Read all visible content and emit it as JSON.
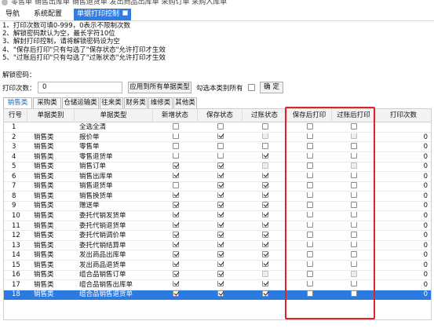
{
  "topbar": {
    "ghost_text": "零售单  销售出库单  销售退货单  发出商品出库单  采购订单  采购入库单"
  },
  "nav": {
    "items": [
      {
        "label": "导航"
      },
      {
        "label": "系统配置"
      },
      {
        "label": "单据打印控制"
      }
    ]
  },
  "notes": [
    "1、打印次数可填0-999，0表示不限制次数",
    "2、解锁密码默认为空，最长字符10位",
    "3、解封打印控制，请将解锁密码设为空",
    "4、\"保存后打印\"只有勾选了\"保存状态\"允许打印才生效",
    "5、\"过账后打印\"只有勾选了\"过账状态\"允许打印才生效"
  ],
  "password_label": "解锁密码：",
  "controls": {
    "print_count_label": "打印次数：",
    "print_count_value": "0",
    "apply_all_label": "应用到所有单据类型",
    "check_all_label": "勾选本类别所有",
    "confirm_label": "确 定"
  },
  "tabs": [
    {
      "label": "销售类",
      "active": true
    },
    {
      "label": "采购类",
      "active": false
    },
    {
      "label": "仓储运输类",
      "active": false
    },
    {
      "label": "往来类",
      "active": false
    },
    {
      "label": "财务类",
      "active": false
    },
    {
      "label": "维修类",
      "active": false
    },
    {
      "label": "其他类",
      "active": false
    }
  ],
  "table": {
    "columns": [
      "行号",
      "单据类别",
      "单据类型",
      "新增状态",
      "保存状态",
      "过账状态",
      "保存后打印",
      "过账后打印",
      "打印次数"
    ],
    "rows": [
      {
        "no": "1",
        "category": "",
        "type": "全选全清",
        "add": false,
        "save": false,
        "post": false,
        "save_print": false,
        "post_print": false,
        "count": "",
        "post_disabled": false
      },
      {
        "no": "2",
        "category": "销售类",
        "type": "报价单",
        "add": false,
        "save": true,
        "post": false,
        "save_print": false,
        "post_print": false,
        "count": "0",
        "post_disabled": true
      },
      {
        "no": "3",
        "category": "销售类",
        "type": "零售单",
        "add": false,
        "save": false,
        "post": false,
        "save_print": false,
        "post_print": false,
        "count": "0",
        "post_disabled": false
      },
      {
        "no": "4",
        "category": "销售类",
        "type": "零售退货单",
        "add": false,
        "save": false,
        "post": true,
        "save_print": false,
        "post_print": false,
        "count": "0",
        "post_disabled": false
      },
      {
        "no": "5",
        "category": "销售类",
        "type": "销售订单",
        "add": true,
        "save": true,
        "post": false,
        "save_print": false,
        "post_print": false,
        "count": "0",
        "post_disabled": true
      },
      {
        "no": "6",
        "category": "销售类",
        "type": "销售出库单",
        "add": true,
        "save": true,
        "post": true,
        "save_print": false,
        "post_print": false,
        "count": "0",
        "post_disabled": false
      },
      {
        "no": "7",
        "category": "销售类",
        "type": "销售退货单",
        "add": false,
        "save": true,
        "post": true,
        "save_print": false,
        "post_print": false,
        "count": "0",
        "post_disabled": false
      },
      {
        "no": "8",
        "category": "销售类",
        "type": "销售换货单",
        "add": true,
        "save": true,
        "post": true,
        "save_print": false,
        "post_print": false,
        "count": "0",
        "post_disabled": false
      },
      {
        "no": "9",
        "category": "销售类",
        "type": "赠送单",
        "add": true,
        "save": true,
        "post": true,
        "save_print": false,
        "post_print": false,
        "count": "0",
        "post_disabled": false
      },
      {
        "no": "10",
        "category": "销售类",
        "type": "委托代销发货单",
        "add": true,
        "save": true,
        "post": true,
        "save_print": false,
        "post_print": false,
        "count": "0",
        "post_disabled": false
      },
      {
        "no": "11",
        "category": "销售类",
        "type": "委托代销退货单",
        "add": true,
        "save": true,
        "post": true,
        "save_print": false,
        "post_print": false,
        "count": "0",
        "post_disabled": false
      },
      {
        "no": "12",
        "category": "销售类",
        "type": "委托代销调价单",
        "add": true,
        "save": true,
        "post": true,
        "save_print": false,
        "post_print": false,
        "count": "0",
        "post_disabled": false
      },
      {
        "no": "13",
        "category": "销售类",
        "type": "委托代销结算单",
        "add": true,
        "save": true,
        "post": true,
        "save_print": false,
        "post_print": false,
        "count": "0",
        "post_disabled": false
      },
      {
        "no": "14",
        "category": "销售类",
        "type": "发出商品出库单",
        "add": true,
        "save": true,
        "post": true,
        "save_print": false,
        "post_print": false,
        "count": "0",
        "post_disabled": false
      },
      {
        "no": "15",
        "category": "销售类",
        "type": "发出商品退货单",
        "add": true,
        "save": true,
        "post": true,
        "save_print": false,
        "post_print": false,
        "count": "0",
        "post_disabled": false
      },
      {
        "no": "16",
        "category": "销售类",
        "type": "组合品销售订单",
        "add": true,
        "save": true,
        "post": false,
        "save_print": false,
        "post_print": false,
        "count": "0",
        "post_disabled": true
      },
      {
        "no": "17",
        "category": "销售类",
        "type": "组合品销售出库单",
        "add": true,
        "save": true,
        "post": true,
        "save_print": false,
        "post_print": false,
        "count": "0",
        "post_disabled": false
      },
      {
        "no": "18",
        "category": "销售类",
        "type": "组合品销售退货单",
        "add": true,
        "save": true,
        "post": true,
        "save_print": false,
        "post_print": false,
        "count": "0",
        "post_disabled": false,
        "selected": true
      }
    ]
  },
  "colors": {
    "accent": "#2f7de1",
    "selected_row": "#2a7ae2",
    "highlight_border": "#e02424"
  }
}
